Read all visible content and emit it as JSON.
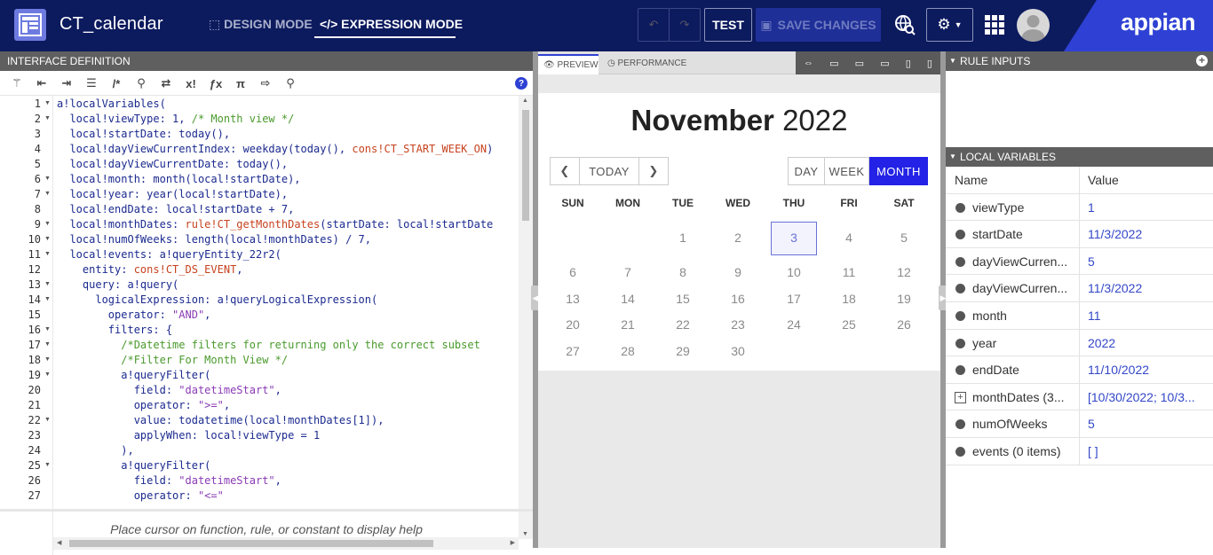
{
  "header": {
    "app_title": "CT_calendar",
    "design_mode": "DESIGN MODE",
    "expression_mode": "EXPRESSION MODE",
    "test": "TEST",
    "save_changes": "SAVE CHANGES",
    "brand": "appian"
  },
  "editor": {
    "panel_title": "INTERFACE DEFINITION",
    "help_text": "Place cursor on function, rule, or constant to display help",
    "line_numbers": [
      "1",
      "2",
      "3",
      "4",
      "5",
      "6",
      "7",
      "8",
      "9",
      "10",
      "11",
      "12",
      "13",
      "14",
      "15",
      "16",
      "17",
      "18",
      "19",
      "20",
      "21",
      "22",
      "23",
      "24",
      "25",
      "26",
      "27"
    ]
  },
  "preview": {
    "tab_preview": "PREVIEW",
    "tab_performance": "PERFORMANCE",
    "month_name": "November",
    "year": "2022",
    "today_button": "TODAY",
    "day_button": "DAY",
    "week_button": "WEEK",
    "month_button": "MONTH",
    "weekdays": [
      "SUN",
      "MON",
      "TUE",
      "WED",
      "THU",
      "FRI",
      "SAT"
    ],
    "weeks": [
      [
        "",
        "",
        "1",
        "2",
        "3",
        "4",
        "5"
      ],
      [
        "6",
        "7",
        "8",
        "9",
        "10",
        "11",
        "12"
      ],
      [
        "13",
        "14",
        "15",
        "16",
        "17",
        "18",
        "19"
      ],
      [
        "20",
        "21",
        "22",
        "23",
        "24",
        "25",
        "26"
      ],
      [
        "27",
        "28",
        "29",
        "30",
        "",
        "",
        ""
      ]
    ],
    "highlighted_day": "3"
  },
  "rule_inputs": {
    "title": "RULE INPUTS"
  },
  "local_variables": {
    "title": "LOCAL VARIABLES",
    "col_name": "Name",
    "col_value": "Value",
    "rows": [
      {
        "name": "viewType",
        "value": "1"
      },
      {
        "name": "startDate",
        "value": "11/3/2022"
      },
      {
        "name": "dayViewCurren...",
        "value": "5"
      },
      {
        "name": "dayViewCurren...",
        "value": "11/3/2022"
      },
      {
        "name": "month",
        "value": "11"
      },
      {
        "name": "year",
        "value": "2022"
      },
      {
        "name": "endDate",
        "value": "11/10/2022"
      },
      {
        "name": "monthDates (3...",
        "value": "[10/30/2022; 10/3..."
      },
      {
        "name": "numOfWeeks",
        "value": "5"
      },
      {
        "name": "events (0 items)",
        "value": "[ ]"
      }
    ]
  }
}
